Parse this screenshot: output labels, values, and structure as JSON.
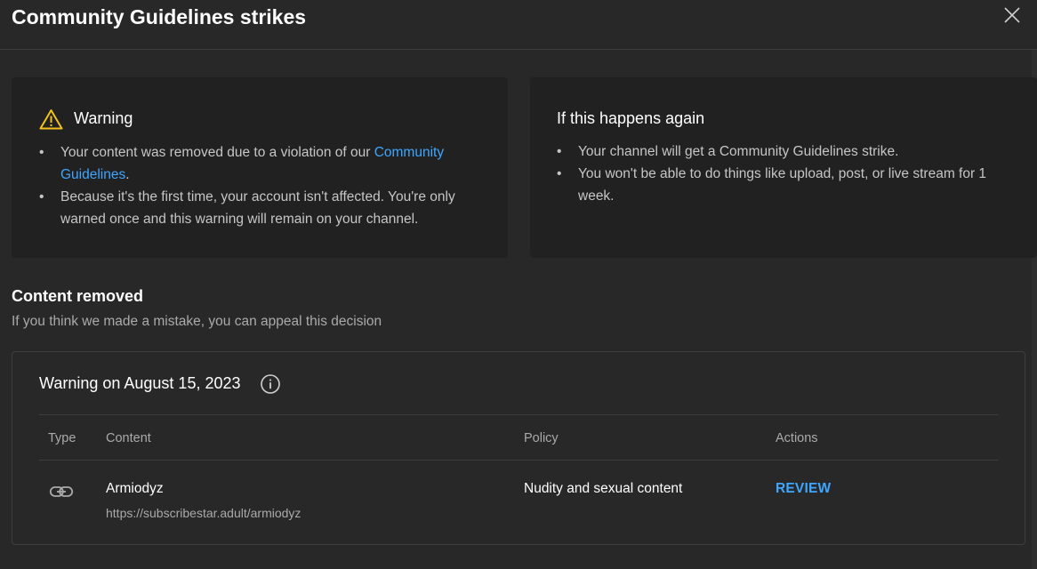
{
  "dialog": {
    "title": "Community Guidelines strikes",
    "close_icon": "close-icon"
  },
  "warning_card": {
    "icon": "warning-triangle-icon",
    "icon_color": "#f2c21b",
    "heading": "Warning",
    "bullet1_prefix": "Your content was removed due to a violation of our ",
    "bullet1_link": "Community Guidelines",
    "bullet1_suffix": ".",
    "bullet2": "Because it's the first time, your account isn't affected. You're only warned once and this warning will remain on your channel."
  },
  "again_card": {
    "heading": "If this happens again",
    "bullet1": "Your channel will get a Community Guidelines strike.",
    "bullet2": "You won't be able to do things like upload, post, or live stream for 1 week."
  },
  "content_removed": {
    "title": "Content removed",
    "subtitle": "If you think we made a mistake, you can appeal this decision"
  },
  "strike": {
    "title": "Warning on August 15, 2023",
    "info_icon": "info-icon",
    "columns": {
      "type": "Type",
      "content": "Content",
      "policy": "Policy",
      "actions": "Actions"
    },
    "row": {
      "type_icon": "link-icon",
      "content_name": "Armiodyz",
      "content_url": "https://subscribestar.adult/armiodyz",
      "policy": "Nudity and sexual content",
      "action": "REVIEW"
    }
  },
  "colors": {
    "background": "#282828",
    "card": "#212121",
    "accent": "#3ea6ff",
    "warning": "#f2c21b"
  }
}
